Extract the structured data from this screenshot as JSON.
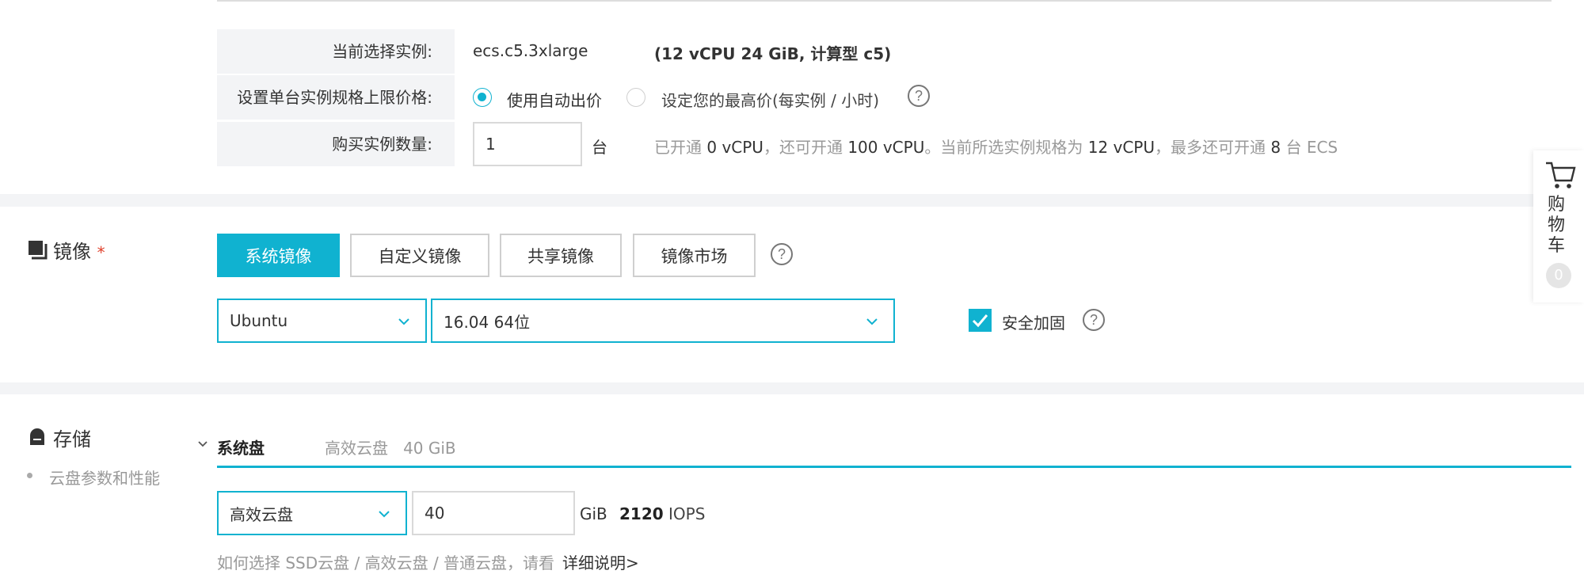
{
  "instance": {
    "current_label": "当前选择实例:",
    "current_value": "ecs.c5.3xlarge",
    "current_spec": "(12 vCPU 24 GiB, 计算型 c5)",
    "price_label": "设置单台实例规格上限价格:",
    "price_auto": "使用自动出价",
    "price_max": "设定您的最高价(每实例 / 小时)",
    "qty_label": "购买实例数量:",
    "qty_value": "1",
    "qty_unit": "台",
    "quota": {
      "t1": "已开通",
      "n1": "0 vCPU",
      "t2": "，还可开通",
      "n2": "100 vCPU",
      "t3": "。当前所选实例规格为",
      "n3": "12 vCPU",
      "t4": "，最多还可开通",
      "n4": "8",
      "t5": "台 ECS"
    }
  },
  "image": {
    "title": "镜像",
    "required_mark": "*",
    "tabs": [
      "系统镜像",
      "自定义镜像",
      "共享镜像",
      "镜像市场"
    ],
    "active_tab": 0,
    "os_value": "Ubuntu",
    "version_value": "16.04 64位",
    "security_label": "安全加固",
    "security_checked": true
  },
  "storage": {
    "title": "存储",
    "sub_link": "云盘参数和性能",
    "disk_tab": "系统盘",
    "disk_summary": "高效云盘   40 GiB",
    "disk_type": "高效云盘",
    "disk_size": "40",
    "size_unit": "GiB",
    "iops_value": "2120",
    "iops_unit": "IOPS",
    "help_text": "如何选择 SSD云盘 / 高效云盘 / 普通云盘，请看",
    "help_link": "详细说明>"
  },
  "cart": {
    "label": "购物车",
    "count": "0"
  },
  "colors": {
    "accent": "#10b2d0",
    "required": "#e0402b"
  }
}
